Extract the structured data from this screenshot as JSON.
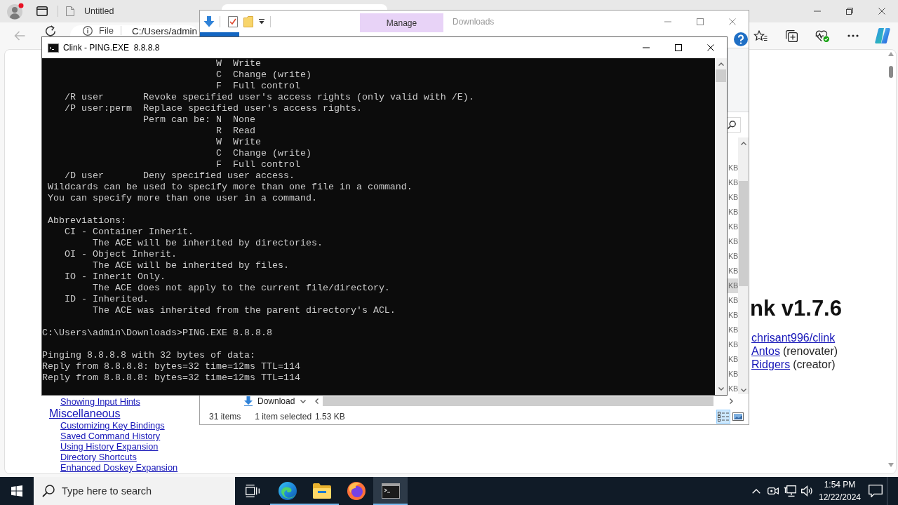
{
  "browser": {
    "tabs": [
      {
        "title": "Untitled",
        "selected": false
      },
      {
        "selected": true
      }
    ],
    "address": {
      "chip": "File",
      "value": "C:/Users/admin"
    },
    "page": {
      "links": [
        {
          "kind": "sub",
          "text": "Showing Input Hints"
        },
        {
          "kind": "section",
          "text": "Miscellaneous"
        },
        {
          "kind": "sub",
          "text": "Customizing Key Bindings"
        },
        {
          "kind": "sub",
          "text": "Saved Command History"
        },
        {
          "kind": "sub",
          "text": "Using History Expansion"
        },
        {
          "kind": "sub",
          "text": "Directory Shortcuts"
        },
        {
          "kind": "sub",
          "text": "Enhanced Doskey Expansion"
        }
      ],
      "heading": "nk v1.7.6",
      "credits": [
        {
          "link": "chrisant996/clink"
        },
        {
          "link": "Antos",
          "note": "(renovater)"
        },
        {
          "link": "Ridgers",
          "note": "(creator)"
        }
      ]
    }
  },
  "explorer": {
    "title": "Downloads",
    "context_tab": "Manage",
    "nav_item": "Download",
    "files": [
      {
        "size": "KB",
        "selected": false
      },
      {
        "size": "KB",
        "selected": false
      },
      {
        "size": "KB",
        "selected": false
      },
      {
        "size": "KB",
        "selected": false
      },
      {
        "size": "KB",
        "selected": false
      },
      {
        "size": "KB",
        "selected": false
      },
      {
        "size": "KB",
        "selected": false
      },
      {
        "size": "KB",
        "selected": false
      },
      {
        "size": "KB",
        "selected": true
      },
      {
        "size": "KB",
        "selected": false
      },
      {
        "size": "KB",
        "selected": false
      },
      {
        "size": "KB",
        "selected": false
      },
      {
        "size": "KB",
        "selected": false
      },
      {
        "size": "KB",
        "selected": false
      },
      {
        "size": "KB",
        "selected": false
      },
      {
        "size": "KB",
        "selected": false
      }
    ],
    "status": {
      "count": "31 items",
      "selection": "1 item selected",
      "size": "1.53 KB"
    },
    "views": [
      {
        "kind": "details",
        "selected": true
      },
      {
        "kind": "large_icons",
        "selected": false
      }
    ]
  },
  "console": {
    "title": "Clink - PING.EXE  8.8.8.8",
    "blocks": [
      [
        "                               W  Write",
        "                               C  Change (write)",
        "                               F  Full control",
        "    /R user       Revoke specified user's access rights (only valid with /E).",
        "    /P user:perm  Replace specified user's access rights.",
        "                  Perm can be: N  None",
        "                               R  Read",
        "                               W  Write",
        "                               C  Change (write)",
        "                               F  Full control",
        "    /D user       Deny specified user access.",
        " Wildcards can be used to specify more than one file in a command.",
        " You can specify more than one user in a command."
      ],
      [
        " Abbreviations:",
        "    CI - Container Inherit.",
        "         The ACE will be inherited by directories.",
        "    OI - Object Inherit.",
        "         The ACE will be inherited by files.",
        "    IO - Inherit Only.",
        "         The ACE does not apply to the current file/directory.",
        "    ID - Inherited.",
        "         The ACE was inherited from the parent directory's ACL."
      ],
      [
        "C:\\Users\\admin\\Downloads>PING.EXE 8.8.8.8"
      ],
      [
        "Pinging 8.8.8.8 with 32 bytes of data:",
        "Reply from 8.8.8.8: bytes=32 time=12ms TTL=114",
        "Reply from 8.8.8.8: bytes=32 time=12ms TTL=114"
      ]
    ]
  },
  "taskbar": {
    "search": {
      "placeholder": "Type here to search"
    },
    "apps": [
      {
        "kind": "edge",
        "running": true,
        "selected": false
      },
      {
        "kind": "explorer",
        "running": true,
        "selected": false
      },
      {
        "kind": "firefox",
        "running": false,
        "selected": false
      },
      {
        "kind": "terminal",
        "running": true,
        "selected": true
      }
    ],
    "time": "1:54 PM",
    "date": "12/22/2024"
  }
}
